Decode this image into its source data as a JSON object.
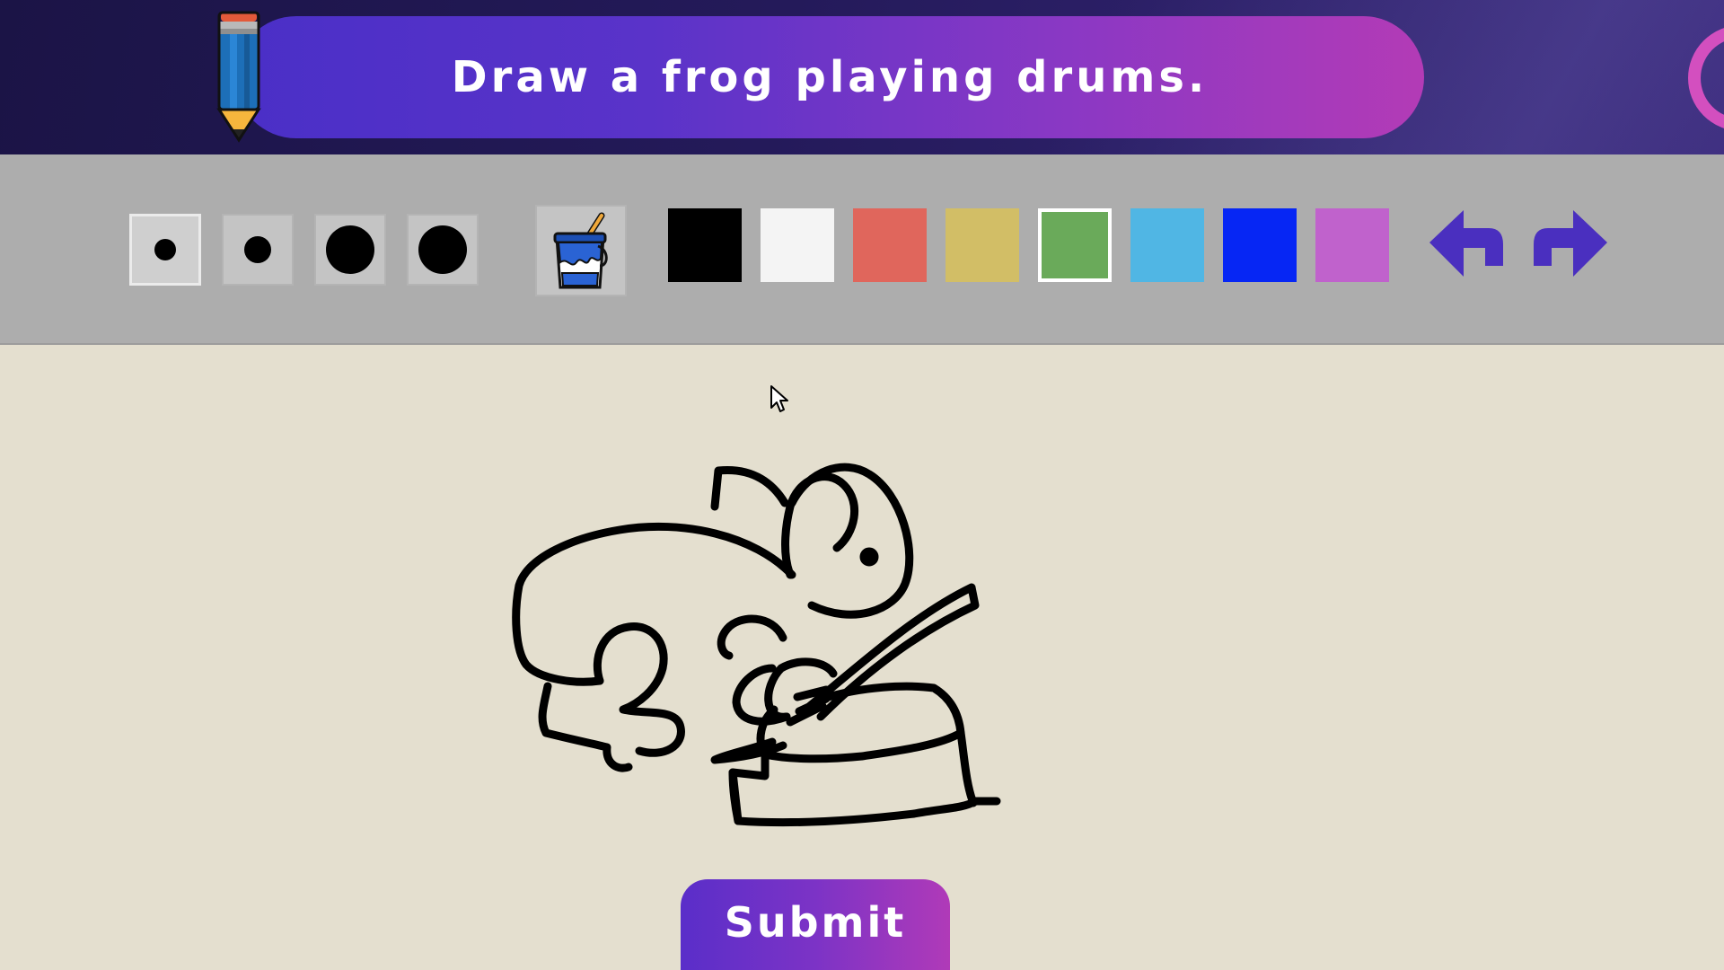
{
  "header": {
    "prompt": "Draw a frog playing drums."
  },
  "toolbar": {
    "brush_sizes": [
      {
        "name": "size-1",
        "selected": true
      },
      {
        "name": "size-2",
        "selected": false
      },
      {
        "name": "size-3",
        "selected": false
      },
      {
        "name": "size-4",
        "selected": false
      }
    ],
    "fill_tool_icon": "paint-bucket-icon",
    "colors": [
      {
        "name": "black",
        "hex": "#000000",
        "selected": false
      },
      {
        "name": "white",
        "hex": "#f4f4f4",
        "selected": false
      },
      {
        "name": "red",
        "hex": "#e0665c",
        "selected": false
      },
      {
        "name": "gold",
        "hex": "#d2be66",
        "selected": false
      },
      {
        "name": "green",
        "hex": "#6aaa5a",
        "selected": true
      },
      {
        "name": "light-blue",
        "hex": "#50b6e4",
        "selected": false
      },
      {
        "name": "blue",
        "hex": "#0626f4",
        "selected": false
      },
      {
        "name": "purple",
        "hex": "#c062cc",
        "selected": false
      }
    ],
    "undo_icon": "undo-arrow-icon",
    "redo_icon": "redo-arrow-icon",
    "arrow_color": "#4a2fbf"
  },
  "accent_colors": {
    "banner_bg": "#1f1650",
    "prompt_gradient_start": "#4a2fc7",
    "prompt_gradient_end": "#b33bb6",
    "toolbar_bg": "#adadad",
    "canvas_bg": "#e4dfcf"
  },
  "submit": {
    "label": "Submit"
  }
}
